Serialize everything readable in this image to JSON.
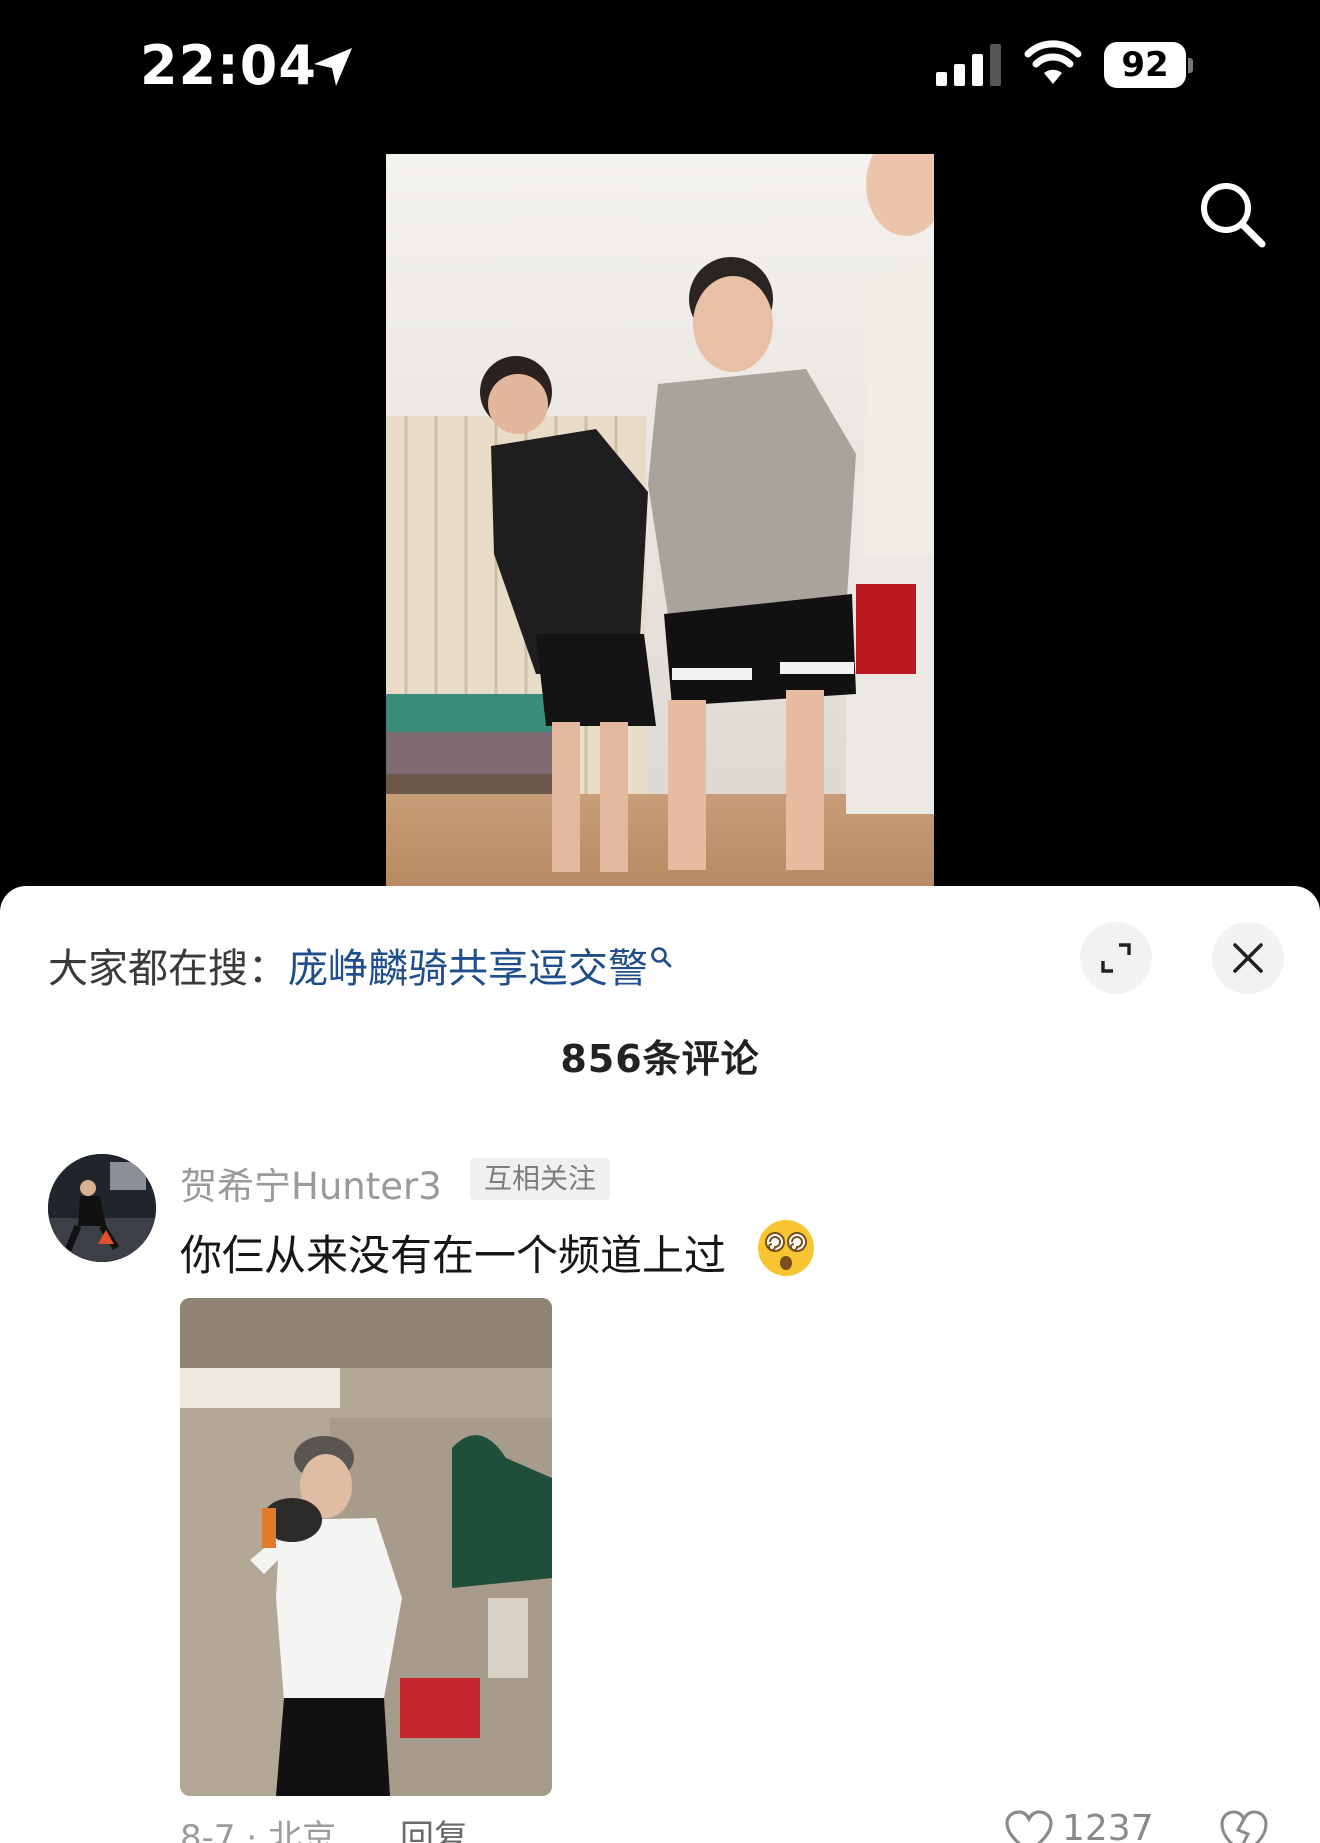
{
  "status_bar": {
    "time": "22:04",
    "battery": "92"
  },
  "sheet": {
    "hot_search_prefix": "大家都在搜：",
    "hot_search_keyword": "庞峥麟骑共享逗交警",
    "comment_count": "856条评论"
  },
  "comment": {
    "username": "贺希宁Hunter3",
    "badge": "互相关注",
    "text": "你仨从来没有在一个频道上过",
    "date_location": "8-7 · 北京",
    "reply_label": "回复",
    "like_count": "1237"
  },
  "icons": {
    "location": "location-arrow-icon",
    "signal": "cellular-signal-icon",
    "wifi": "wifi-icon",
    "search": "search-icon",
    "expand": "expand-icon",
    "close": "close-icon",
    "like": "heart-icon",
    "dislike": "dislike-icon",
    "emoji": "dizzy-face-emoji"
  }
}
